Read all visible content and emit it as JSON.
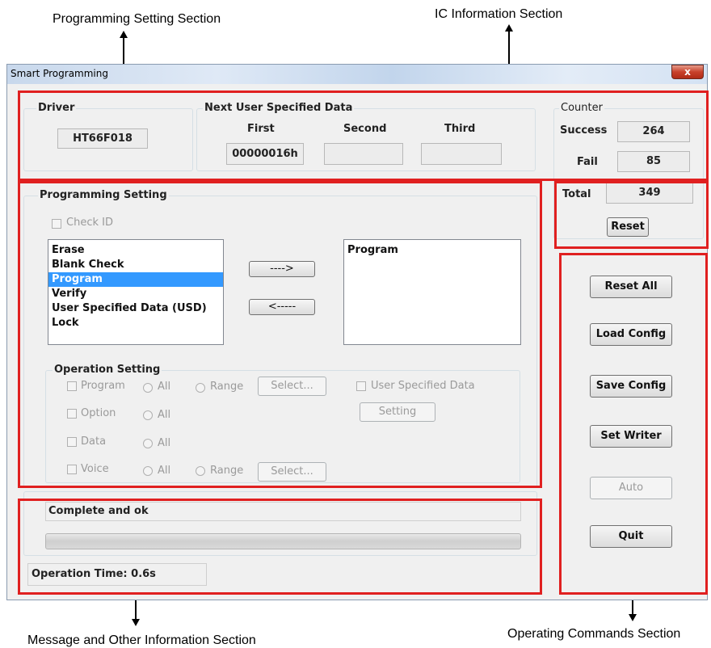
{
  "annotations": {
    "programming_setting_section": "Programming Setting Section",
    "ic_information_section": "IC Information Section",
    "message_section": "Message and Other Information Section",
    "operating_commands_section": "Operating Commands Section"
  },
  "window": {
    "title": "Smart Programming",
    "close_label": "x"
  },
  "driver": {
    "legend": "Driver",
    "value": "HT66F018"
  },
  "usd": {
    "legend": "Next User Specified Data",
    "first_label": "First",
    "second_label": "Second",
    "third_label": "Third",
    "first_value": "00000016h",
    "second_value": "",
    "third_value": ""
  },
  "counter": {
    "legend": "Counter",
    "success_label": "Success",
    "success_value": "264",
    "fail_label": "Fail",
    "fail_value": "85",
    "total_label": "Total",
    "total_value": "349",
    "reset_label": "Reset"
  },
  "programming": {
    "legend": "Programming Setting",
    "check_id_label": "Check ID",
    "available_items": [
      "Erase",
      "Blank Check",
      "Program",
      "Verify",
      "User Specified Data (USD)",
      "Lock"
    ],
    "selected_index": 2,
    "chosen_items": [
      "Program"
    ],
    "add_label": "---->",
    "remove_label": "<-----"
  },
  "operation": {
    "legend": "Operation Setting",
    "program_label": "Program",
    "option_label": "Option",
    "data_label": "Data",
    "voice_label": "Voice",
    "all_label": "All",
    "range_label": "Range",
    "select_label": "Select...",
    "usd_label": "User Specified Data",
    "setting_label": "Setting"
  },
  "message": {
    "text": "Complete and ok",
    "progress": 0,
    "op_time": "Operation Time: 0.6s"
  },
  "commands": {
    "reset_all": "Reset All",
    "load_config": "Load Config",
    "save_config": "Save Config",
    "set_writer": "Set Writer",
    "auto": "Auto",
    "quit": "Quit"
  }
}
